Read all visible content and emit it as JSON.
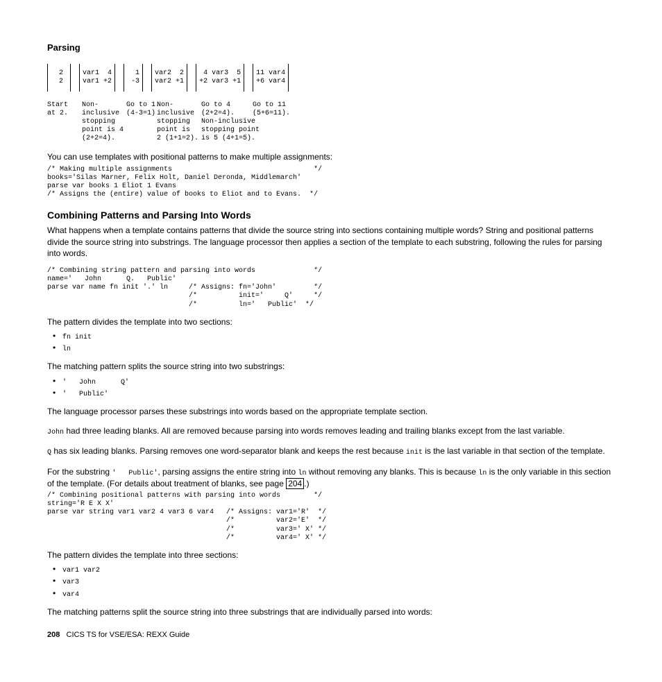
{
  "running_head": "Parsing",
  "diagram": {
    "boxes": [
      {
        "l1": "  2 ",
        "l2": "  2 "
      },
      {
        "l1": "var1  4",
        "l2": "var1 +2"
      },
      {
        "l1": "  1",
        "l2": " -3"
      },
      {
        "l1": "var2  2",
        "l2": "var2 +1"
      },
      {
        "l1": " 4 var3  5",
        "l2": "+2 var3 +1"
      },
      {
        "l1": "11 var4",
        "l2": "+6 var4"
      }
    ],
    "captions": {
      "c1": "Start\nat 2.",
      "c2": "Non-\ninclusive\nstopping\npoint is 4\n(2+2=4).",
      "c3": "Go to 1.\n(4-3=1)",
      "c4": "Non-\ninclusive\nstopping\npoint is\n2 (1+1=2).",
      "c5": "Go to 4\n(2+2=4).\nNon-inclusive\nstopping point\nis 5 (4+1=5).",
      "c6": "Go to 11\n(5+6=11)."
    }
  },
  "p_templates_intro": "You can use templates with positional patterns to make multiple assignments:",
  "code_block_1": "/* Making multiple assignments                                  */\nbooks='Silas Marner, Felix Holt, Daniel Deronda, Middlemarch'\nparse var books 1 Eliot 1 Evans\n/* Assigns the (entire) value of books to Eliot and to Evans.  */",
  "heading_combining": "Combining Patterns and Parsing Into Words",
  "p_combining_body": "What happens when a template contains patterns that divide the source string into sections containing multiple words? String and positional patterns divide the source string into substrings. The language processor then applies a section of the template to each substring, following the rules for parsing into words.",
  "code_block_2": "/* Combining string pattern and parsing into words              */\nname='   John      Q.   Public'\nparse var name fn init '.' ln     /* Assigns: fn='John'         */\n                                  /*          init='     Q'     */\n                                  /*          ln='   Public'  */",
  "p_two_sections": "The pattern divides the template into two sections:",
  "bullets_1": {
    "b1": "fn init",
    "b2": "ln"
  },
  "p_two_substrings": "The matching pattern splits the source string into two substrings:",
  "bullets_2": {
    "b1": "'   John      Q'",
    "b2": "'   Public'"
  },
  "p_lang_proc": "The language processor parses these substrings into words based on the appropriate template section.",
  "p_john_1a": "John",
  "p_john_1b": " had three leading blanks. All are removed because parsing into words removes leading and trailing blanks except from the last variable.",
  "p_q_1a": "Q",
  "p_q_1b": " has six leading blanks. Parsing removes one word-separator blank and keeps the rest because ",
  "p_q_1c": "init",
  "p_q_1d": " is the last variable in that section of the template.",
  "p_substring_a": "For the substring ",
  "p_substring_code1": "'   Public'",
  "p_substring_b": ", parsing assigns the entire string into ",
  "p_substring_code2": "ln",
  "p_substring_c": " without removing any blanks. This is because ",
  "p_substring_code3": "ln",
  "p_substring_d": " is the only variable in this section of the template. (For details about treatment of blanks, see page ",
  "p_substring_link": "204",
  "p_substring_e": ".)",
  "code_block_3": "/* Combining positional patterns with parsing into words        */\nstring='R E X X'\nparse var string var1 var2 4 var3 6 var4   /* Assigns: var1='R'  */\n                                           /*          var2='E'  */\n                                           /*          var3=' X' */\n                                           /*          var4=' X' */",
  "p_three_sections": "The pattern divides the template into three sections:",
  "bullets_3": {
    "b1": "var1 var2",
    "b2": "var3",
    "b3": "var4"
  },
  "p_three_substrings": "The matching patterns split the source string into three substrings that are individually parsed into words:",
  "footer": {
    "page_num": "208",
    "footer_text": "CICS TS for VSE/ESA:  REXX Guide"
  }
}
